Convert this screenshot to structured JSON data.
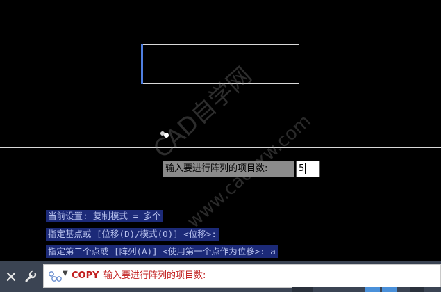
{
  "prompt": {
    "label": "输入要进行阵列的项目数:",
    "value": "5"
  },
  "history": [
    "当前设置:  复制模式 = 多个",
    "指定基点或 [位移(D)/模式(O)] <位移>:",
    "指定第二个点或 [阵列(A)] <使用第一个点作为位移>: a"
  ],
  "command_line": {
    "command": "COPY",
    "prompt_text": "输入要进行阵列的项目数:",
    "icons": [
      "close-icon",
      "wrench-icon",
      "chain-icon",
      "dropdown-arrow-icon"
    ]
  },
  "watermark": {
    "main": "CAD自学网",
    "sub": "www.cadzxw.com"
  },
  "colors": {
    "canvas_bg": "#000000",
    "crosshair": "#d8d8d8",
    "history_bg": "#1c2a78",
    "history_text": "#b9c3ef",
    "prompt_bg": "#8b8b8b",
    "command_text": "#c21f1f",
    "commandbar_bg": "#3b4453",
    "selected_edge": "#4f7fe0"
  }
}
